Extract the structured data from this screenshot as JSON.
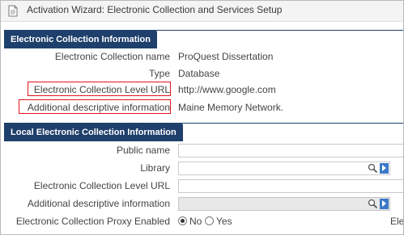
{
  "window": {
    "title": "Activation Wizard: Electronic Collection and Services Setup",
    "icon": "wizard-page-icon"
  },
  "electronic_collection_information": {
    "section_title": "Electronic Collection Information",
    "fields": [
      {
        "label": "Electronic Collection name",
        "value": "ProQuest Dissertation",
        "highlighted": false
      },
      {
        "label": "Type",
        "value": "Database",
        "highlighted": false
      },
      {
        "label": "Electronic Collection Level URL",
        "value": "http://www.google.com",
        "highlighted": true
      },
      {
        "label": "Additional descriptive information",
        "value": "Maine Memory Network.",
        "highlighted": true
      }
    ],
    "highlight_color": "#e0141e"
  },
  "local_electronic_collection_information": {
    "section_title": "Local Electronic Collection Information",
    "fields": [
      {
        "label": "Public name",
        "value": "",
        "control": "text-input"
      },
      {
        "label": "Library",
        "value": "",
        "control": "lookup-input",
        "icons": [
          "search-icon",
          "arrow-right-icon"
        ]
      },
      {
        "label": "Electronic Collection Level URL",
        "value": "",
        "control": "text-input"
      },
      {
        "label": "Additional descriptive information",
        "value": "",
        "control": "lookup-input-disabled",
        "icons": [
          "search-icon",
          "arrow-right-icon"
        ]
      }
    ],
    "proxy": {
      "label": "Electronic Collection Proxy Enabled",
      "options": [
        {
          "label": "No",
          "selected": true
        },
        {
          "label": "Yes",
          "selected": false
        }
      ],
      "trailing_text": "Ele"
    }
  },
  "colors": {
    "section_header": "#1f3f6c",
    "accent_button": "#3a78c8"
  }
}
